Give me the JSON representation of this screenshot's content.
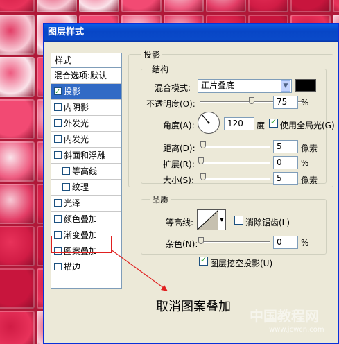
{
  "window": {
    "title": "图层样式"
  },
  "style_list": {
    "header": "样式",
    "blend_options": "混合选项:默认",
    "items": [
      {
        "label": "投影",
        "checked": true,
        "selected": true
      },
      {
        "label": "内阴影",
        "checked": false
      },
      {
        "label": "外发光",
        "checked": false
      },
      {
        "label": "内发光",
        "checked": false
      },
      {
        "label": "斜面和浮雕",
        "checked": false
      },
      {
        "label": "等高线",
        "checked": false,
        "sub": true
      },
      {
        "label": "纹理",
        "checked": false,
        "sub": true
      },
      {
        "label": "光泽",
        "checked": false
      },
      {
        "label": "颜色叠加",
        "checked": false
      },
      {
        "label": "渐变叠加",
        "checked": false
      },
      {
        "label": "图案叠加",
        "checked": false,
        "highlighted": true
      },
      {
        "label": "描边",
        "checked": false
      }
    ]
  },
  "shadow": {
    "group_title": "投影",
    "structure_title": "结构",
    "blend_mode_label": "混合模式:",
    "blend_mode_value": "正片叠底",
    "shadow_color": "#000000",
    "opacity_label": "不透明度(O):",
    "opacity_value": "75",
    "opacity_unit": "%",
    "angle_label": "角度(A):",
    "angle_value": "120",
    "angle_unit": "度",
    "global_light_label": "使用全局光(G)",
    "global_light_checked": true,
    "distance_label": "距离(D):",
    "distance_value": "5",
    "distance_unit": "像素",
    "spread_label": "扩展(R):",
    "spread_value": "0",
    "spread_unit": "%",
    "size_label": "大小(S):",
    "size_value": "5",
    "size_unit": "像素"
  },
  "quality": {
    "title": "品质",
    "contour_label": "等高线:",
    "antialias_label": "消除锯齿(L)",
    "noise_label": "杂色(N):",
    "noise_value": "0",
    "noise_unit": "%",
    "knockout_label": "图层挖空投影(U)"
  },
  "annotation": {
    "text": "取消图案叠加",
    "highlight_color": "#e02020"
  },
  "watermark": {
    "text": "中国教程网",
    "url": "www.jcwcn.com"
  }
}
